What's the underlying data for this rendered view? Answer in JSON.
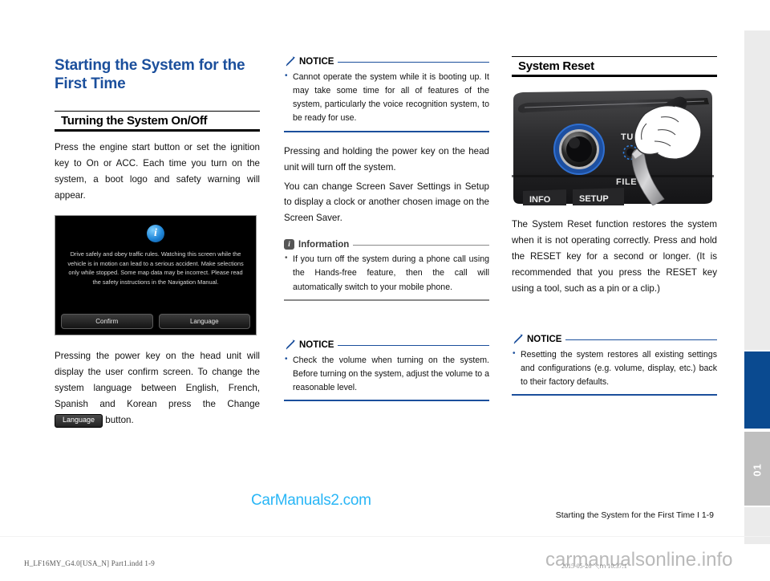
{
  "document": {
    "chapter_title": "Starting the System for the First Time",
    "page_footer": "Starting the System for the First Time I 1-9",
    "tab_number": "01",
    "print_meta": "H_LF16MY_G4.0[USA_N] Part1.indd   1-9",
    "print_date": "2015-05-26   ＼ｍ 10:37:1",
    "watermark_main": "CarManuals2.com",
    "watermark_bottom": "carmanualsonline.info",
    "accent_blue": "#1b4f9c",
    "title_blue": "#1b4f9c",
    "watermark_cyan": "#29b6f6",
    "tab_blue": "#0a4a90"
  },
  "column1": {
    "section_heading": "Turning the System On/Off",
    "paragraph1": "Press the engine start button or set the ignition key to On or ACC. Each time you turn on the system, a boot logo and safety warning will appear.",
    "nav_screen": {
      "icon": "info-circle-icon",
      "icon_glyph": "i",
      "warning_text": "Drive safely and obey traffic rules. Watching this screen while the vehicle is in motion can lead to a serious accident. Make selections only while stopped. Some map data may be incorrect. Please read the safety instructions in the Navigation Manual.",
      "button_confirm": "Confirm",
      "button_language": "Language"
    },
    "paragraph2_a": "Pressing the power key on the head unit will display the user confirm screen. To change the system language between English, French, Spanish and Korean press the Change ",
    "paragraph2_chip": "Language",
    "paragraph2_b": " button."
  },
  "column2": {
    "notice1": {
      "icon": "pencil-icon",
      "title": "NOTICE",
      "bullets": [
        "Cannot operate the system while it is booting up. It may take some time for all of features of the system, particularly the voice recognition system, to be ready for use."
      ]
    },
    "paragraph1": "Pressing and holding the power key on the head unit will turn off the system.",
    "paragraph2": "You can change Screen Saver Settings in Setup to display a clock or another chosen image on the Screen Saver.",
    "information": {
      "icon": "info-badge-icon",
      "icon_glyph": "i",
      "title": "Information",
      "bullets": [
        "If you turn off the system during a phone call using the Hands-free feature, then the call will automatically switch to your mobile phone."
      ]
    },
    "notice2": {
      "icon": "pencil-icon",
      "title": "NOTICE",
      "bullets": [
        "Check the volume when turning on the system. Before turning on the system, adjust the volume to a reasonable level."
      ]
    }
  },
  "column3": {
    "section_heading": "System Reset",
    "photo": {
      "label_tune": "TUNE",
      "label_file": "FILE",
      "button_info": "INFO",
      "button_setup": "SETUP",
      "description": "head-unit-reset-photo"
    },
    "paragraph1": "The System Reset function restores the system when it is not operating correctly. Press and hold the RESET key for a second or longer. (It is recommended that you press the RESET key using a tool, such as a pin or a clip.)",
    "notice1": {
      "icon": "pencil-icon",
      "title": "NOTICE",
      "bullets": [
        "Resetting the system restores all existing settings and configurations (e.g. volume, display, etc.) back to their factory defaults."
      ]
    }
  }
}
